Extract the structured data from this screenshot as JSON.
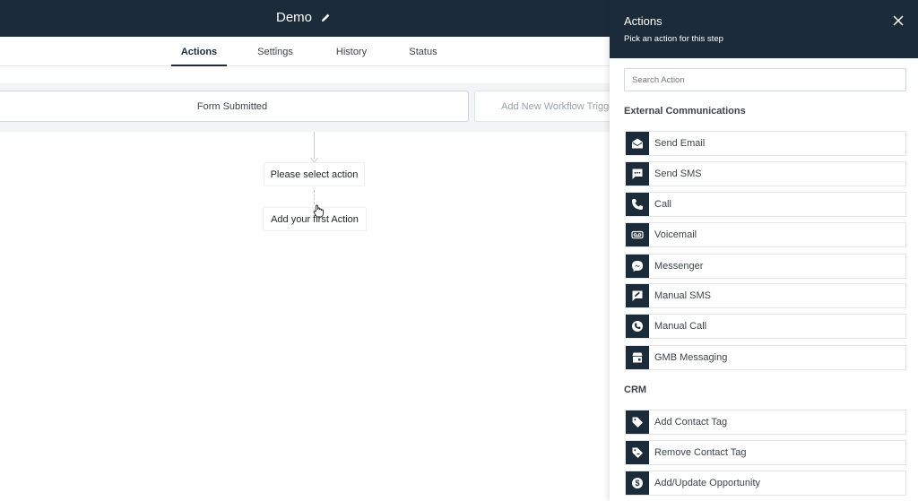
{
  "header": {
    "workflow_name": "Demo"
  },
  "tabs": [
    {
      "label": "Actions",
      "active": true
    },
    {
      "label": "Settings",
      "active": false
    },
    {
      "label": "History",
      "active": false
    },
    {
      "label": "Status",
      "active": false
    }
  ],
  "canvas": {
    "trigger_label": "Form Submitted",
    "add_trigger_label": "Add New Workflow Trigger",
    "select_action_label": "Please select action",
    "add_first_action_label": "Add your first Action"
  },
  "drawer": {
    "title": "Actions",
    "subtitle": "Pick an action for this step",
    "search_placeholder": "Search Action",
    "sections": [
      {
        "title": "External Communications",
        "items": [
          {
            "label": "Send Email",
            "icon": "email-icon"
          },
          {
            "label": "Send SMS",
            "icon": "sms-icon"
          },
          {
            "label": "Call",
            "icon": "phone-icon"
          },
          {
            "label": "Voicemail",
            "icon": "voicemail-icon"
          },
          {
            "label": "Messenger",
            "icon": "messenger-icon"
          },
          {
            "label": "Manual SMS",
            "icon": "manual-sms-icon"
          },
          {
            "label": "Manual Call",
            "icon": "manual-call-icon"
          },
          {
            "label": "GMB Messaging",
            "icon": "gmb-icon"
          }
        ]
      },
      {
        "title": "CRM",
        "items": [
          {
            "label": "Add Contact Tag",
            "icon": "tag-icon"
          },
          {
            "label": "Remove Contact Tag",
            "icon": "remove-tag-icon"
          },
          {
            "label": "Add/Update Opportunity",
            "icon": "dollar-icon"
          }
        ]
      }
    ]
  },
  "colors": {
    "navy": "#1b2b3a",
    "canvas_band": "#f2f4f6",
    "border": "#e1e5e9"
  }
}
